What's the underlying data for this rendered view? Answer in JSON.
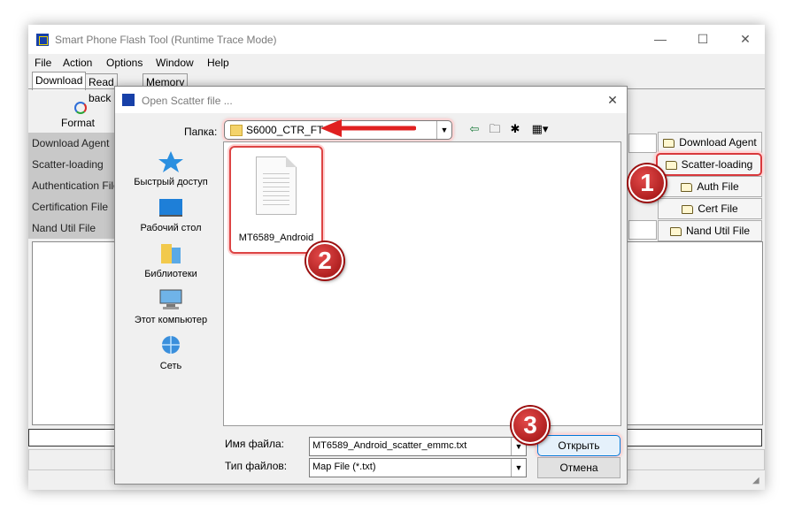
{
  "main_window": {
    "title": "Smart Phone Flash Tool (Runtime Trace Mode)",
    "controls": {
      "minimize": "—",
      "maximize": "☐",
      "close": "✕"
    }
  },
  "menu": [
    "File",
    "Action",
    "Options",
    "Window",
    "Help"
  ],
  "tabs": [
    "Download",
    "Read back",
    "Memory Test"
  ],
  "toolbar": {
    "format_label": "Format"
  },
  "rows": [
    "Download Agent",
    "Scatter-loading File",
    "Authentication File",
    "Certification File",
    "Nand Util File"
  ],
  "side_buttons": [
    "Download Agent",
    "Scatter-loading",
    "Auth File",
    "Cert File",
    "Nand Util File"
  ],
  "dialog": {
    "title": "Open Scatter file ...",
    "close": "✕",
    "folder_label": "Папка:",
    "folder_value": "S6000_CTR_FT",
    "places": [
      "Быстрый доступ",
      "Рабочий стол",
      "Библиотеки",
      "Этот компьютер",
      "Сеть"
    ],
    "file_item": "MT6589_Android",
    "filename_label": "Имя файла:",
    "filename_value": "MT6589_Android_scatter_emmc.txt",
    "filetype_label": "Тип файлов:",
    "filetype_value": "Map File (*.txt)",
    "open_label": "Открыть",
    "cancel_label": "Отмена"
  },
  "annotations": {
    "step1": "1",
    "step2": "2",
    "step3": "3"
  },
  "colors": {
    "highlight": "#d8383c",
    "badge": "#b81c1c",
    "arrow": "#e02020",
    "title_icon": "#1740a8"
  },
  "icons": {
    "back": "arrow-left-icon",
    "up": "folder-up-icon",
    "new_folder": "new-folder-icon",
    "view": "view-menu-icon"
  }
}
